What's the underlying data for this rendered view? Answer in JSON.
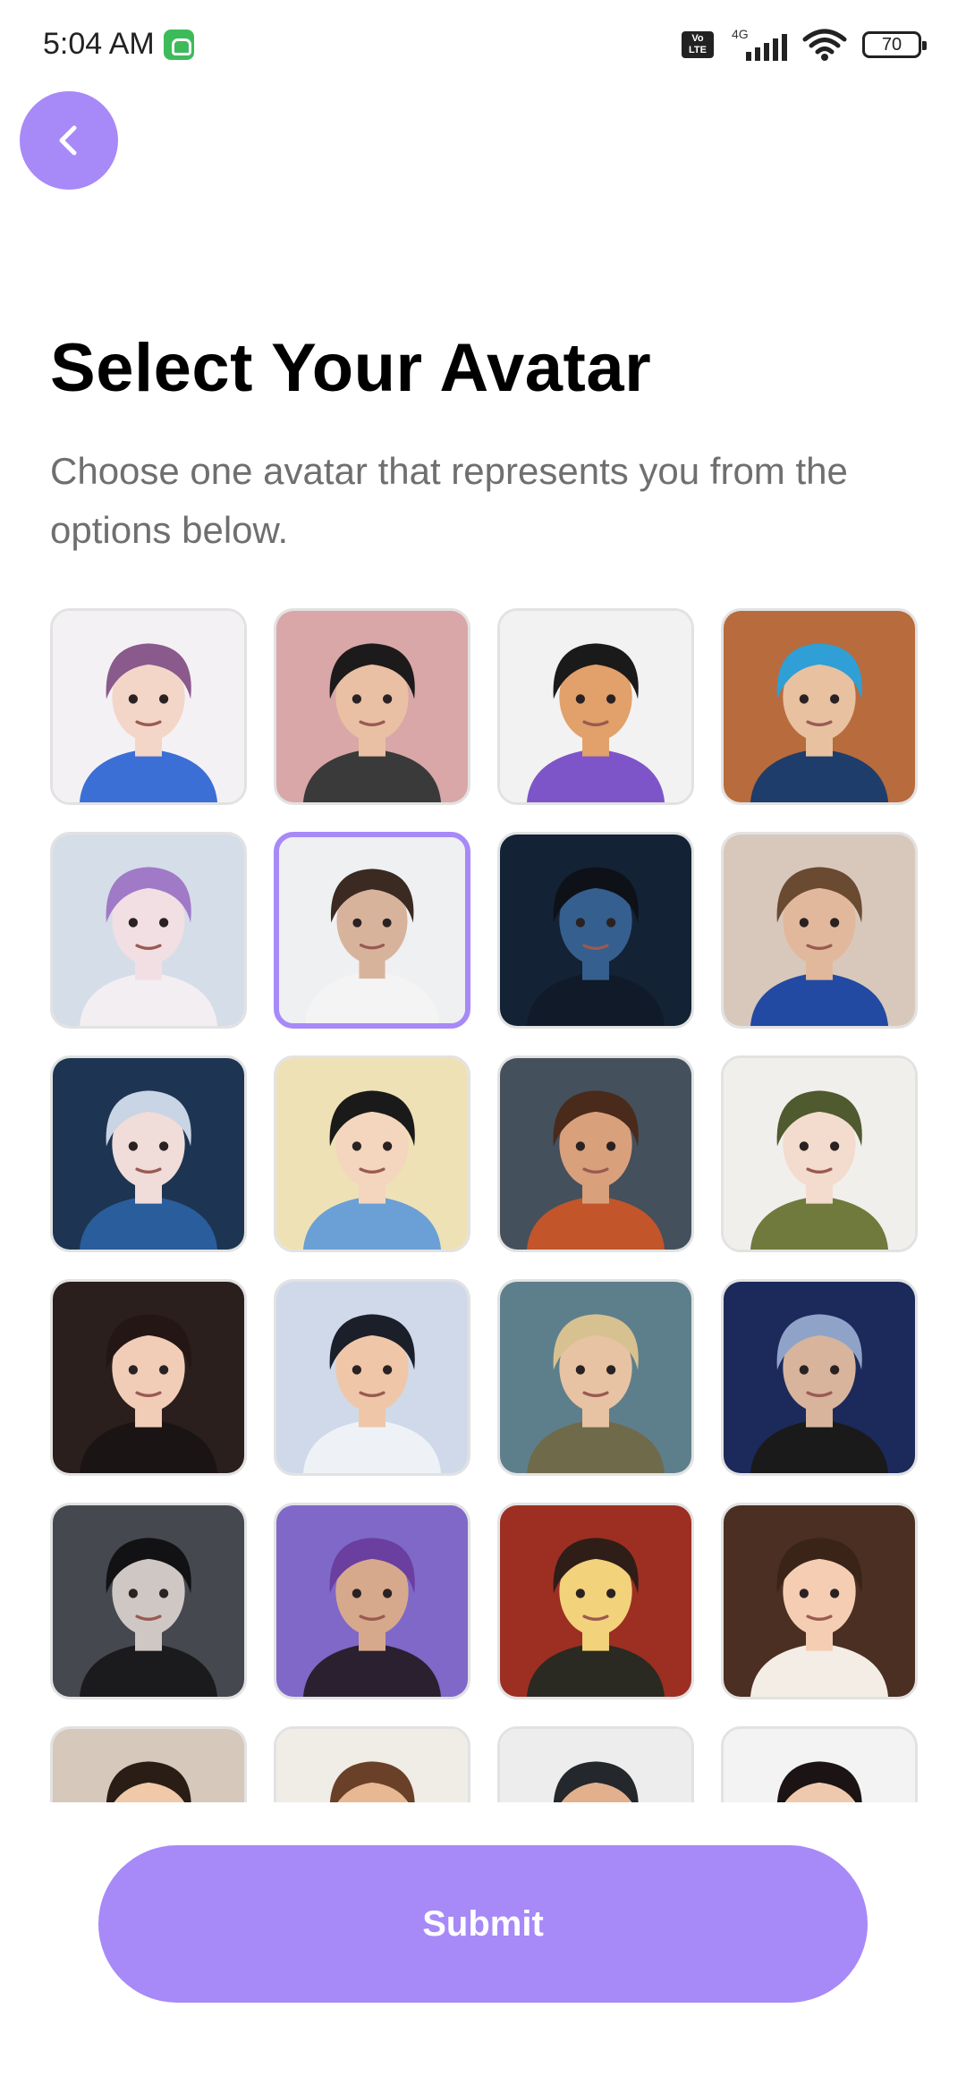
{
  "status_bar": {
    "time": "5:04 AM",
    "volte": "Vo LTE",
    "network": "4G",
    "battery": "70"
  },
  "header": {
    "back_icon": "chevron-left-icon"
  },
  "main": {
    "title": "Select Your Avatar",
    "subtitle": "Choose one avatar that represents you from the options below."
  },
  "avatars": [
    {
      "bg": "#f4f1f4",
      "skin": "#f3d6c8",
      "hair": "#8a5a8c",
      "shirt": "#3b6fd6",
      "selected": false
    },
    {
      "bg": "#d9a7a7",
      "skin": "#e9c0a4",
      "hair": "#1d1a1c",
      "shirt": "#3a3a3a",
      "selected": false
    },
    {
      "bg": "#f2f2f2",
      "skin": "#e2a06a",
      "hair": "#1a1a1a",
      "shirt": "#7e55c9",
      "selected": false
    },
    {
      "bg": "#b86b3c",
      "skin": "#e7c1a0",
      "hair": "#2f9fd6",
      "shirt": "#1e3d6b",
      "selected": false
    },
    {
      "bg": "#d5dde8",
      "skin": "#f2dfe3",
      "hair": "#a07ac7",
      "shirt": "#f3eef2",
      "selected": false
    },
    {
      "bg": "#eef0f2",
      "skin": "#d8b39b",
      "hair": "#3a2a22",
      "shirt": "#f4f4f4",
      "selected": true
    },
    {
      "bg": "#142235",
      "skin": "#355f8e",
      "hair": "#0e1218",
      "shirt": "#111a28",
      "selected": false
    },
    {
      "bg": "#d8c8bc",
      "skin": "#e2b89c",
      "hair": "#6b4a32",
      "shirt": "#234aa2",
      "selected": false
    },
    {
      "bg": "#1d3552",
      "skin": "#f0dcd8",
      "hair": "#c9d4e4",
      "shirt": "#2a5d9c",
      "selected": false
    },
    {
      "bg": "#efe1b6",
      "skin": "#f3d6bd",
      "hair": "#1a1a1a",
      "shirt": "#6aa0d6",
      "selected": false
    },
    {
      "bg": "#44505c",
      "skin": "#d9a07c",
      "hair": "#4a2a1a",
      "shirt": "#c2552a",
      "selected": false
    },
    {
      "bg": "#f1efec",
      "skin": "#f3dccd",
      "hair": "#4f5a2e",
      "shirt": "#6f7a3c",
      "selected": false
    },
    {
      "bg": "#2a1f1c",
      "skin": "#f1cdb8",
      "hair": "#241614",
      "shirt": "#1a1414",
      "selected": false
    },
    {
      "bg": "#cfd9ea",
      "skin": "#efc7a8",
      "hair": "#1b1f2a",
      "shirt": "#eef2f7",
      "selected": false
    },
    {
      "bg": "#5d7f8c",
      "skin": "#e7c3a3",
      "hair": "#d8c190",
      "shirt": "#6f6b4a",
      "selected": false
    },
    {
      "bg": "#1b2a5a",
      "skin": "#d7b49b",
      "hair": "#8fa3c8",
      "shirt": "#1a1a1a",
      "selected": false
    },
    {
      "bg": "#45484f",
      "skin": "#cfc7c4",
      "hair": "#121214",
      "shirt": "#1b1b1d",
      "selected": false
    },
    {
      "bg": "#7f68c8",
      "skin": "#d7a98c",
      "hair": "#6a3fa0",
      "shirt": "#2a2030",
      "selected": false
    },
    {
      "bg": "#9c2f22",
      "skin": "#f2d27a",
      "hair": "#2f1d18",
      "shirt": "#2a2a22",
      "selected": false
    },
    {
      "bg": "#4a2f22",
      "skin": "#f4cdb3",
      "hair": "#3a2418",
      "shirt": "#f3ede5",
      "selected": false
    },
    {
      "bg": "#d6c9bb",
      "skin": "#efc9a8",
      "hair": "#2a1d16",
      "shirt": "#eee",
      "selected": false
    },
    {
      "bg": "#f0ece6",
      "skin": "#e8b893",
      "hair": "#6a4128",
      "shirt": "#eee",
      "selected": false
    },
    {
      "bg": "#ededed",
      "skin": "#e2b08c",
      "hair": "#24282c",
      "shirt": "#eee",
      "selected": false
    },
    {
      "bg": "#f3f3f3",
      "skin": "#efc9ad",
      "hair": "#1c1414",
      "shirt": "#eee",
      "selected": false
    }
  ],
  "submit_label": "Submit",
  "colors": {
    "accent": "#a789f8",
    "text_primary": "#000000",
    "text_secondary": "#6f6f6f",
    "tile_border": "#e2e2e2"
  }
}
